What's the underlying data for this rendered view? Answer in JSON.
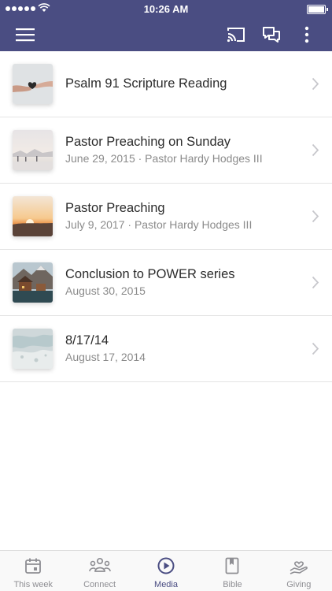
{
  "status_bar": {
    "time": "10:26 AM"
  },
  "media_items": [
    {
      "title": "Psalm 91 Scripture Reading",
      "subtitle": "",
      "thumb": "hands-heart"
    },
    {
      "title": "Pastor Preaching on Sunday",
      "subtitle": "June 29, 2015 · Pastor Hardy Hodges III",
      "thumb": "misty-lake"
    },
    {
      "title": "Pastor Preaching",
      "subtitle": "July 9, 2017 · Pastor Hardy Hodges III",
      "thumb": "sunset"
    },
    {
      "title": "Conclusion to POWER series",
      "subtitle": "August 30, 2015",
      "thumb": "mountain-cabin"
    },
    {
      "title": "8/17/14",
      "subtitle": "August 17, 2014",
      "thumb": "ocean-foam"
    }
  ],
  "tabs": [
    {
      "label": "This week",
      "icon": "calendar-icon",
      "active": false
    },
    {
      "label": "Connect",
      "icon": "people-icon",
      "active": false
    },
    {
      "label": "Media",
      "icon": "play-circle-icon",
      "active": true
    },
    {
      "label": "Bible",
      "icon": "bookmark-book-icon",
      "active": false
    },
    {
      "label": "Giving",
      "icon": "hand-heart-icon",
      "active": false
    }
  ],
  "colors": {
    "brand": "#4a4d82",
    "inactive": "#8e8e93"
  }
}
